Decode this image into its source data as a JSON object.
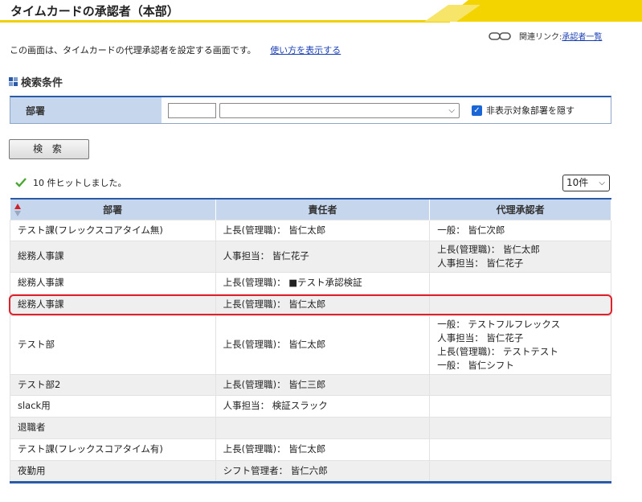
{
  "page": {
    "title": "タイムカードの承認者（本部）",
    "related_prefix": "関連リンク:",
    "related_link": "承認者一覧",
    "intro_text": "この画面は、タイムカードの代理承認者を設定する画面です。",
    "intro_link": "使い方を表示する"
  },
  "search": {
    "section_title": "検索条件",
    "dept_label": "部署",
    "hide_label": "非表示対象部署を隠す",
    "hide_checked": true,
    "button_label": "検 索"
  },
  "results": {
    "hits_text": "10 件ヒットしました。",
    "per_page": "10件",
    "columns": [
      "部署",
      "責任者",
      "代理承認者"
    ],
    "rows": [
      {
        "dept": "テスト課(フレックスコアタイム無)",
        "manager": "上長(管理職)： 皆仁太郎",
        "proxy": [
          "一般： 皆仁次郎"
        ]
      },
      {
        "dept": "総務人事課",
        "manager": "人事担当： 皆仁花子",
        "proxy": [
          "上長(管理職)： 皆仁太郎",
          "人事担当： 皆仁花子"
        ]
      },
      {
        "dept": "総務人事課",
        "manager": "上長(管理職)： ■テスト承認検証",
        "proxy": []
      },
      {
        "dept": "総務人事課",
        "manager": "上長(管理職)： 皆仁太郎",
        "proxy": []
      },
      {
        "dept": "テスト部",
        "manager": "上長(管理職)： 皆仁太郎",
        "proxy": [
          "一般： テストフルフレックス",
          "人事担当： 皆仁花子",
          "上長(管理職)： テストテスト",
          "一般： 皆仁シフト"
        ]
      },
      {
        "dept": "テスト部2",
        "manager": "上長(管理職)： 皆仁三郎",
        "proxy": []
      },
      {
        "dept": "slack用",
        "manager": "人事担当： 検証スラック",
        "proxy": []
      },
      {
        "dept": "退職者",
        "manager": "",
        "proxy": []
      },
      {
        "dept": "テスト課(フレックスコアタイム有)",
        "manager": "上長(管理職)： 皆仁太郎",
        "proxy": []
      },
      {
        "dept": "夜勤用",
        "manager": "シフト管理者： 皆仁六郎",
        "proxy": []
      }
    ]
  },
  "colors": {
    "header_blue": "#c6d6ec",
    "border_blue": "#2b5aa8",
    "accent_yellow": "#f0d000",
    "highlight_red": "#e0202a"
  }
}
